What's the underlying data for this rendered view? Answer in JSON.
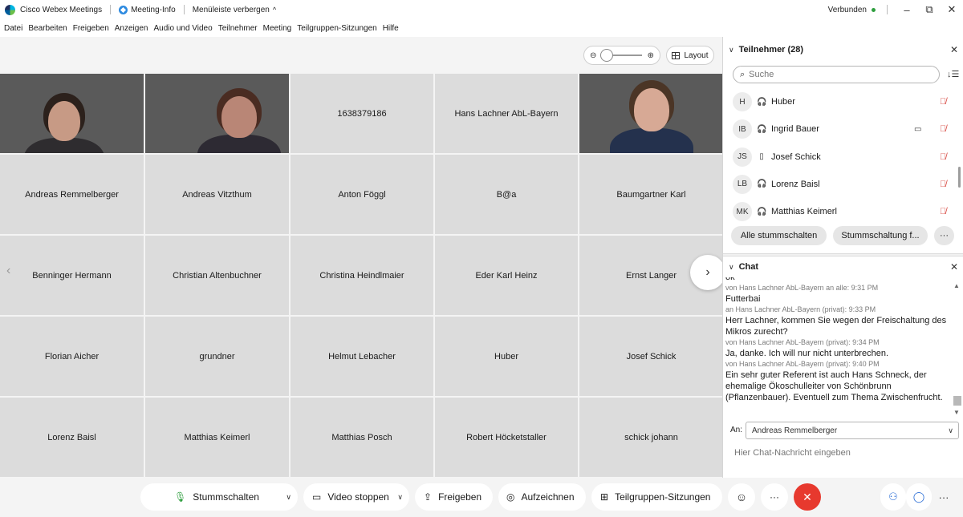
{
  "titlebar": {
    "app_name": "Cisco Webex Meetings",
    "meeting_info": "Meeting-Info",
    "hide_menu": "Menüleiste verbergen",
    "hide_menu_chevron": "^",
    "status": "Verbunden",
    "min": "–",
    "restore": "⧉",
    "close": "✕"
  },
  "menu": [
    "Datei",
    "Bearbeiten",
    "Freigeben",
    "Anzeigen",
    "Audio und Video",
    "Teilnehmer",
    "Meeting",
    "Teilgruppen-Sitzungen",
    "Hilfe"
  ],
  "stage": {
    "zoom_out": "⊖",
    "zoom_in": "⊕",
    "layout_label": "Layout",
    "prev": "‹",
    "next": "›"
  },
  "tiles": [
    {
      "label": "",
      "video": "v1"
    },
    {
      "label": "",
      "video": "v2"
    },
    {
      "label": "1638379186",
      "video": ""
    },
    {
      "label": "Hans Lachner AbL-Bayern",
      "video": ""
    },
    {
      "label": "",
      "video": "v3"
    },
    {
      "label": "Andreas Remmelberger",
      "video": ""
    },
    {
      "label": "Andreas Vitzthum",
      "video": ""
    },
    {
      "label": "Anton Föggl",
      "video": ""
    },
    {
      "label": "B@a",
      "video": ""
    },
    {
      "label": "Baumgartner Karl",
      "video": ""
    },
    {
      "label": "Benninger Hermann",
      "video": ""
    },
    {
      "label": "Christian Altenbuchner",
      "video": ""
    },
    {
      "label": "Christina Heindlmaier",
      "video": ""
    },
    {
      "label": "Eder Karl Heinz",
      "video": ""
    },
    {
      "label": "Ernst Langer",
      "video": ""
    },
    {
      "label": "Florian Aicher",
      "video": ""
    },
    {
      "label": "grundner",
      "video": ""
    },
    {
      "label": "Helmut Lebacher",
      "video": ""
    },
    {
      "label": "Huber",
      "video": ""
    },
    {
      "label": "Josef Schick",
      "video": ""
    },
    {
      "label": "Lorenz Baisl",
      "video": ""
    },
    {
      "label": "Matthias Keimerl",
      "video": ""
    },
    {
      "label": "Matthias Posch",
      "video": ""
    },
    {
      "label": "Robert Höcketstaller",
      "video": ""
    },
    {
      "label": "schick johann",
      "video": ""
    }
  ],
  "participants_panel": {
    "title": "Teilnehmer (28)",
    "search_placeholder": "Suche",
    "items": [
      {
        "initials": "H",
        "name": "Huber",
        "device": "🎧",
        "camera": ""
      },
      {
        "initials": "IB",
        "name": "Ingrid Bauer",
        "device": "🎧",
        "camera": "▭"
      },
      {
        "initials": "JS",
        "name": "Josef Schick",
        "device": "▯",
        "camera": ""
      },
      {
        "initials": "LB",
        "name": "Lorenz Baisl",
        "device": "🎧",
        "camera": ""
      },
      {
        "initials": "MK",
        "name": "Matthias Keimerl",
        "device": "🎧",
        "camera": ""
      }
    ],
    "mute_all": "Alle stummschalten",
    "mute_on_entry": "Stummschaltung f...",
    "more": "···"
  },
  "chat_panel": {
    "title": "Chat",
    "messages": [
      {
        "meta": "von Hans Lachner AbL-Bayern an alle:   9:31 PM",
        "text": "Futterbai"
      },
      {
        "meta": "an Hans Lachner AbL-Bayern (privat):   9:33 PM",
        "text": "Herr Lachner, kommen Sie wegen der Freischaltung des Mikros zurecht?"
      },
      {
        "meta": "von Hans Lachner AbL-Bayern (privat):   9:34 PM",
        "text": "Ja, danke. Ich will nur nicht unterbrechen."
      },
      {
        "meta": "von Hans Lachner AbL-Bayern (privat):   9:40 PM",
        "text": "Ein sehr guter Referent ist auch Hans Schneck, der ehemalige Ökoschulleiter von Schönbrunn (Pflanzenbauer). Eventuell zum Thema Zwischenfrucht."
      }
    ],
    "to_label": "An:",
    "to_value": "Andreas Remmelberger",
    "input_placeholder": "Hier Chat-Nachricht eingeben"
  },
  "controls": {
    "mute": "Stummschalten",
    "video": "Video stoppen",
    "share": "Freigeben",
    "record": "Aufzeichnen",
    "breakout": "Teilgruppen-Sitzungen",
    "reactions": "☺",
    "more": "···",
    "end": "✕",
    "participants": "⚇",
    "chat": "◯",
    "more_right": "···"
  },
  "colors": {
    "end_call": "#e7392e",
    "mute_red": "#d6423a",
    "connected_green": "#2e9e3e"
  }
}
